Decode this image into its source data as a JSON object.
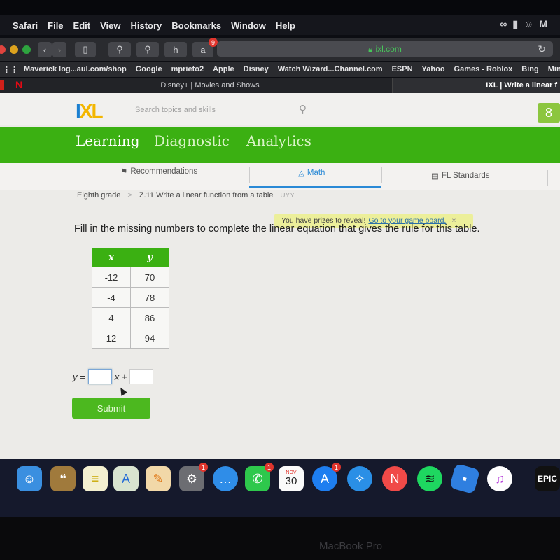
{
  "menubar": {
    "app": "Safari",
    "items": [
      "File",
      "Edit",
      "View",
      "History",
      "Bookmarks",
      "Window",
      "Help"
    ]
  },
  "toolbar": {
    "extension_badge": "9",
    "url": "ixl.com"
  },
  "bookmarks": [
    "Maverick log...aul.com/shop",
    "Google",
    "mprieto2",
    "Apple",
    "Disney",
    "Watch Wizard...Channel.com",
    "ESPN",
    "Yahoo",
    "Games - Roblox",
    "Bing",
    "Minecraft.msi.exe"
  ],
  "tabs": [
    {
      "title": "Disney+ | Movies and Shows"
    },
    {
      "title": "IXL | Write a linear f"
    }
  ],
  "ixl": {
    "logo": {
      "i": "I",
      "x": "X",
      "l": "L"
    },
    "search_placeholder": "Search topics and skills",
    "user_icon": "8",
    "nav": [
      "Learning",
      "Diagnostic",
      "Analytics"
    ],
    "subnav": [
      "Recommendations",
      "Math",
      "FL Standards"
    ],
    "breadcrumb": {
      "grade": "Eighth grade",
      "sep": ">",
      "skill": "Z.11 Write a linear function from a table",
      "code": "UYY"
    },
    "prize": {
      "text": "You have prizes to reveal!",
      "link": "Go to your game board.",
      "close": "×"
    },
    "question": "Fill in the missing numbers to complete the linear equation that gives the rule for this table.",
    "table": {
      "headers": [
        "x",
        "y"
      ],
      "rows": [
        [
          "-12",
          "70"
        ],
        [
          "-4",
          "78"
        ],
        [
          "4",
          "86"
        ],
        [
          "12",
          "94"
        ]
      ]
    },
    "equation": {
      "lhs": "y =",
      "mid": "x +",
      "slope_value": "",
      "intercept_value": ""
    },
    "submit": "Submit"
  },
  "dock": {
    "items": [
      "Finder",
      "Contacts",
      "Notes",
      "Maps",
      "Pages",
      "System Preferences",
      "Messages",
      "FaceTime",
      "Calendar",
      "App Store",
      "Safari",
      "News",
      "Spotify",
      "Roblox",
      "iTunes",
      "Epic Games"
    ],
    "calendar": {
      "month": "NOV",
      "day": "30"
    },
    "badges": {
      "system_preferences": "1",
      "facetime": "1",
      "app_store": "1"
    },
    "epic": "EPIC"
  },
  "bezel_label": "MacBook Pro"
}
